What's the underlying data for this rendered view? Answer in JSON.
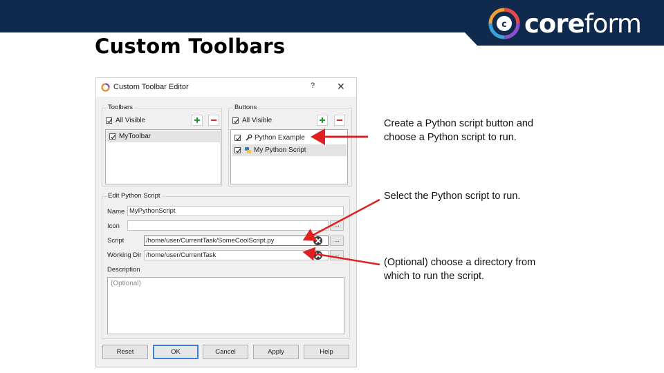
{
  "slide": {
    "title": "Custom Toolbars",
    "banner_color": "#0f2a4c",
    "logo": {
      "text_bold": "core",
      "text_light": "form"
    }
  },
  "dialog": {
    "title": "Custom Toolbar Editor",
    "help_glyph": "?",
    "close_glyph": "✕",
    "toolbars": {
      "label": "Toolbars",
      "all_visible_label": "All Visible",
      "items": [
        {
          "label": "MyToolbar",
          "checked": true,
          "selected": true
        }
      ]
    },
    "buttons": {
      "label": "Buttons",
      "all_visible_label": "All Visible",
      "items": [
        {
          "label": "Python Example",
          "checked": true,
          "icon": "wrench-icon",
          "selected": false
        },
        {
          "label": "My Python Script",
          "checked": true,
          "icon": "python-icon",
          "selected": true
        }
      ]
    },
    "edit": {
      "label": "Edit Python Script",
      "name_label": "Name",
      "name_value": "MyPythonScript",
      "icon_label": "Icon",
      "icon_value": "",
      "script_label": "Script",
      "script_value": "/home/user/CurrentTask/SomeCoolScript.py",
      "workdir_label": "Working Dir",
      "workdir_value": "/home/user/CurrentTask",
      "description_label": "Description",
      "description_placeholder": "(Optional)",
      "browse_label": "..."
    },
    "footer_buttons": {
      "reset": "Reset",
      "ok": "OK",
      "cancel": "Cancel",
      "apply": "Apply",
      "help": "Help"
    }
  },
  "annotations": [
    {
      "text": "Create a Python script button and choose a Python script to run."
    },
    {
      "text": "Select the Python script to run."
    },
    {
      "text": "(Optional) choose a directory from which to run the script."
    }
  ],
  "colors": {
    "arrow": "#e02020",
    "plus": "#1f9a2d",
    "minus": "#d62b2b",
    "default_button_border": "#3c7fd6"
  }
}
